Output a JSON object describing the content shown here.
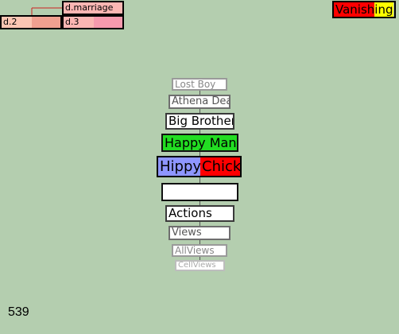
{
  "family_tree": {
    "marriage_label": "d.marriage",
    "child_left_label": "d.2",
    "child_right_label": "d.3",
    "link_color": "#cc2222"
  },
  "vanishing": {
    "part_red": "Vanish",
    "part_yellow": "ing",
    "colors": {
      "red": "#ff0000",
      "yellow": "#ffff00"
    }
  },
  "stack": {
    "lost_boy": "Lost Boy",
    "athena": "Athena Dea",
    "big_brother": "Big Brother",
    "happy_man": "Happy Man",
    "hippy": "Hippy",
    "chick": "Chick",
    "blank": "",
    "actions": "Actions",
    "views": "Views",
    "allviews": "AllViews",
    "cellviews": "CellViews"
  },
  "colors": {
    "background": "#b4ceaf",
    "happy_man": "#22dd22",
    "hippy": "#8e96ff",
    "chick": "#ff0000"
  },
  "counter": "539"
}
